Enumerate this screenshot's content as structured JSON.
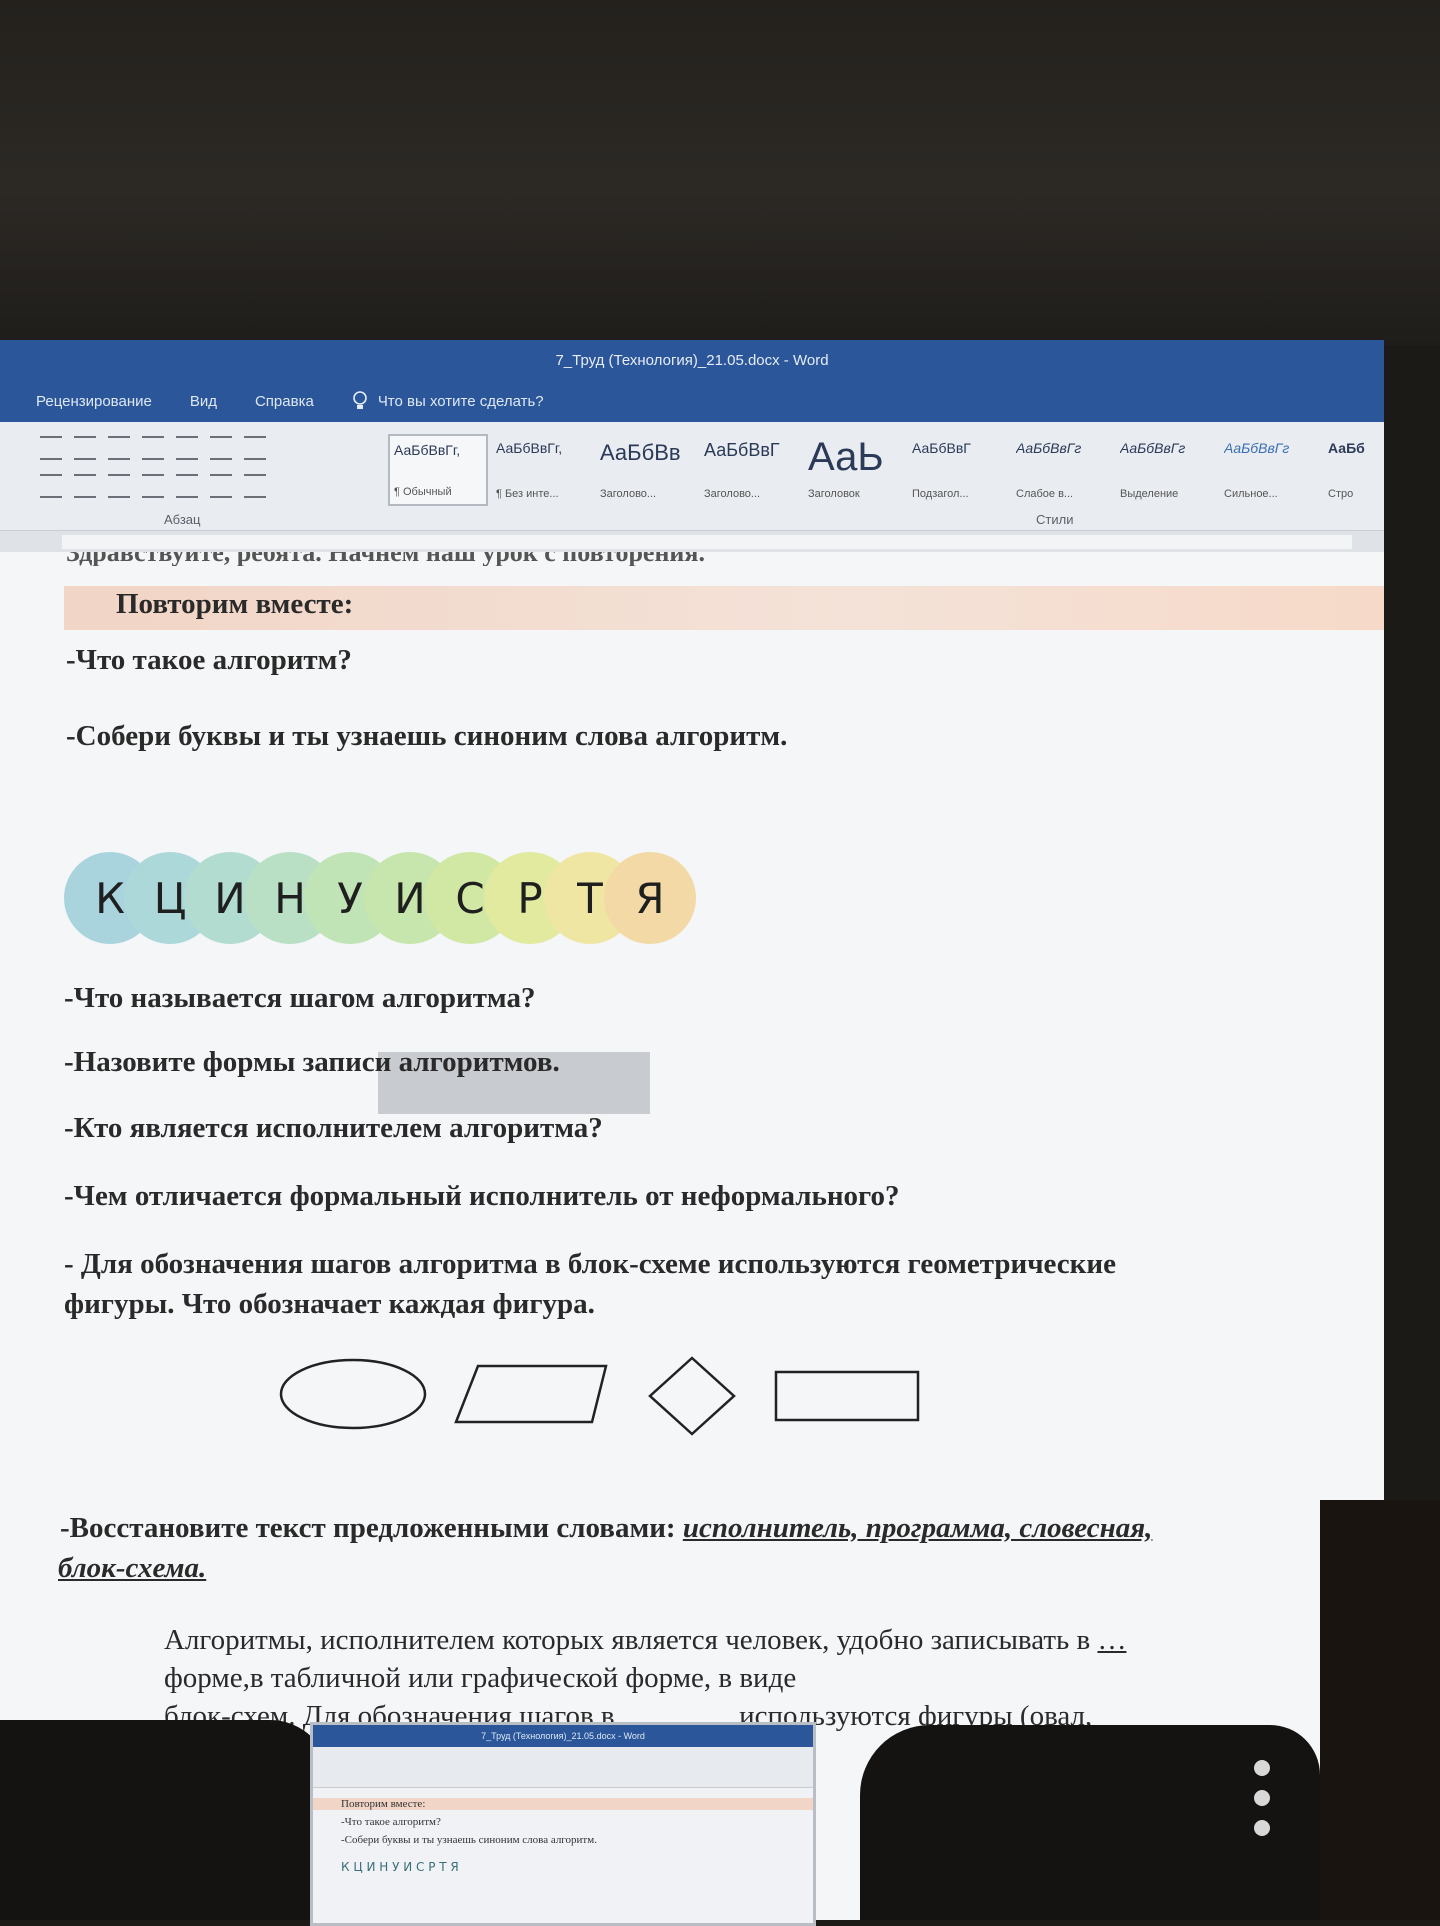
{
  "window": {
    "title": "7_Труд (Технология)_21.05.docx - Word"
  },
  "menu": {
    "items": [
      "Рецензирование",
      "Вид",
      "Справка"
    ],
    "tell_me": "Что вы хотите сделать?"
  },
  "ribbon": {
    "paragraph_group_label": "Абзац",
    "styles_group_label": "Стили",
    "styles": [
      {
        "sample": "АаБбВвГг,",
        "name": "¶ Обычный"
      },
      {
        "sample": "АаБбВвГг,",
        "name": "¶ Без инте..."
      },
      {
        "sample": "АаБбВв",
        "name": "Заголово..."
      },
      {
        "sample": "АаБбВвГ",
        "name": "Заголово..."
      },
      {
        "sample": "АаЬ",
        "name": "Заголовок"
      },
      {
        "sample": "АаБбВвГ",
        "name": "Подзагол..."
      },
      {
        "sample": "АаБбВвГг",
        "name": "Слабое в..."
      },
      {
        "sample": "АаБбВвГг",
        "name": "Выделение"
      },
      {
        "sample": "АаБбВвГг",
        "name": "Сильное..."
      },
      {
        "sample": "АаБб",
        "name": "Стро"
      }
    ]
  },
  "document": {
    "cut_line": "Здравствуйте, ребята. Начнем наш урок с повторения.",
    "heading": "Повторим вместе:",
    "q1": "-Что такое алгоритм?",
    "q2": "-Собери буквы и ты узнаешь синоним слова алгоритм.",
    "letters": [
      "К",
      "Ц",
      "И",
      "Н",
      "У",
      "И",
      "С",
      "Р",
      "Т",
      "Я"
    ],
    "q3": "-Что называется шагом алгоритма?",
    "q4": "-Назовите формы записи алгоритмов.",
    "q5": "-Кто является исполнителем алгоритма?",
    "q6": "-Чем отличается формальный исполнитель от неформального?",
    "q7_line1": "- Для обозначения шагов алгоритма в блок-схеме используются  геометрические",
    "q7_line2": "фигуры. Что обозначает каждая фигура.",
    "restore_prefix": "-Восстановите текст предложенными словами: ",
    "restore_words_line1": "исполнитель, программа, словесная,",
    "restore_words_line2": "блок-схема.",
    "p_line1": "Алгоритмы, исполнителем которых является человек, удобно записывать в",
    "p_blank": "…",
    "p_line2": "форме,в табличной или графической форме, в виде",
    "p_line3": "блок-схем. Для обозначения шагов в",
    "p_line3b": "используются фигуры (овал,"
  },
  "thumbnail": {
    "title": "7_Труд (Технология)_21.05.docx - Word",
    "heading": "Повторим вместе:",
    "q1": "-Что такое алгоритм?",
    "q2": "-Собери буквы и ты узнаешь синоним слова алгоритм.",
    "letters": "К Ц И Н У И С Р Т Я"
  },
  "colors": {
    "word_blue": "#2b579a",
    "band": "#f1d5c6",
    "letter_circles": [
      "#a9d4de",
      "#acd8d9",
      "#b3dcd1",
      "#b9e0c4",
      "#c1e4b6",
      "#c7e6ad",
      "#d1e8a4",
      "#e1ea9e",
      "#f0e6a4",
      "#f3d9a6"
    ]
  }
}
